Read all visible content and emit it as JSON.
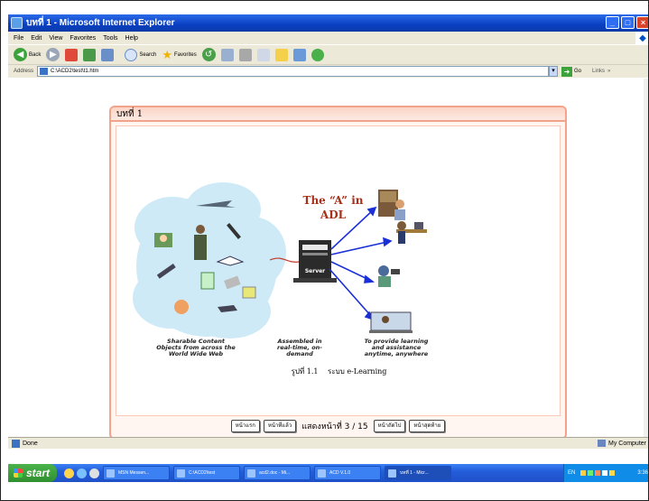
{
  "window": {
    "title": "บทที่ 1 - Microsoft Internet Explorer"
  },
  "menu": [
    "File",
    "Edit",
    "View",
    "Favorites",
    "Tools",
    "Help"
  ],
  "toolbar": {
    "back_label": "Back",
    "search_label": "Search",
    "favorites_label": "Favorites"
  },
  "address": {
    "label": "Address",
    "url": "C:\\ACD2\\test\\t1.htm",
    "go_label": "Go",
    "links_label": "Links"
  },
  "page": {
    "heading": "บทที่ 1",
    "figure": {
      "title_line1": "The “A” in",
      "title_line2": "ADL",
      "server_label": "Server",
      "left_caption": [
        "Sharable Content",
        "Objects from across the",
        "World Wide Web"
      ],
      "middle_caption": [
        "Assembled in",
        "real-time, on-",
        "demand"
      ],
      "right_caption": [
        "To provide learning",
        "and assistance",
        "anytime, anywhere"
      ]
    },
    "caption_number": "รูปที่ 1.1",
    "caption_text": "ระบบ e-Learning",
    "nav": {
      "first": "หน้าแรก",
      "prev": "หน้าที่แล้ว",
      "page_info": "แสดงหน้าที่ 3 / 15",
      "next": "หน้าถัดไป",
      "last": "หน้าสุดท้าย"
    }
  },
  "status": {
    "text": "Done",
    "zone": "My Computer"
  },
  "taskbar": {
    "start_label": "start",
    "items": [
      "MSN Messen...",
      "C:\\ACD2\\test",
      "acd2.doc - Mi...",
      "ACD V.1.0",
      "บทที่ 1 - Micr..."
    ],
    "lang": "EN",
    "clock": "3:36"
  },
  "colors": {
    "title_bar": "#0a3fc2",
    "content_border": "#f4a28a",
    "arrow_blue": "#1a2fd8",
    "figure_title": "#a8301a"
  }
}
